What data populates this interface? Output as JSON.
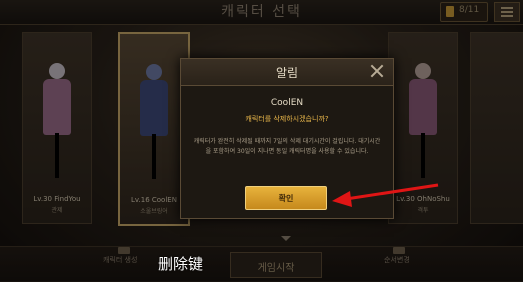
{
  "header": {
    "title": "캐릭터 선택",
    "slots": "8/11"
  },
  "characters": [
    {
      "level_name": "Lv.30 FindYou",
      "class": "관제",
      "head": "#c9c0c8",
      "body": "#9b6d8a"
    },
    {
      "level_name": "Lv.16 CoolEN",
      "class": "소울브링어",
      "head": "#6e7aa6",
      "body": "#3e4a7a"
    },
    {
      "level_name": "Lv.30 OhNoShu",
      "class": "격투",
      "head": "#b7a39c",
      "body": "#8a5a78"
    }
  ],
  "dialog": {
    "title": "알림",
    "character_name": "CoolEN",
    "question": "캐릭터를 삭제하시겠습니까?",
    "message": "캐릭터가 완전히 삭제될 때까지 7일의 삭제 대기시간이 걸립니다. 대기시간을 포함하여 30일이 지나면 동일 캐릭터명을 사용할 수 있습니다.",
    "confirm_label": "확인"
  },
  "bottom": {
    "left_label": "캐릭터 생성",
    "start_label": "게임시작",
    "right_label": "순서변경",
    "caption": "删除键"
  },
  "colors": {
    "confirm_button": "#d9a02c",
    "question_text": "#e8b64a",
    "arrow": "#e01515"
  }
}
